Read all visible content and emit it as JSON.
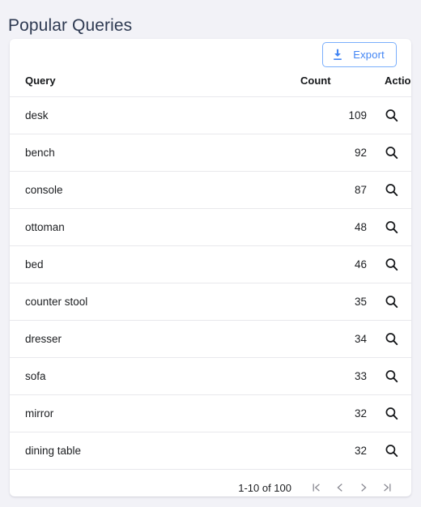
{
  "page": {
    "title": "Popular Queries",
    "background_color": "#f2f2f7",
    "title_color": "#2e3a52"
  },
  "toolbar": {
    "export_label": "Export",
    "export_icon": "download-icon",
    "accent_color": "#4285f4"
  },
  "table": {
    "columns": [
      {
        "key": "query",
        "label": "Query"
      },
      {
        "key": "count",
        "label": "Count"
      },
      {
        "key": "actions",
        "label": "Actions"
      }
    ],
    "row_action_icon": "search-icon",
    "rows": [
      {
        "query": "desk",
        "count": "109"
      },
      {
        "query": "bench",
        "count": "92"
      },
      {
        "query": "console",
        "count": "87"
      },
      {
        "query": "ottoman",
        "count": "48"
      },
      {
        "query": "bed",
        "count": "46"
      },
      {
        "query": "counter stool",
        "count": "35"
      },
      {
        "query": "dresser",
        "count": "34"
      },
      {
        "query": "sofa",
        "count": "33"
      },
      {
        "query": "mirror",
        "count": "32"
      },
      {
        "query": "dining table",
        "count": "32"
      }
    ]
  },
  "pagination": {
    "range_label": "1-10 of 100",
    "buttons": [
      {
        "name": "first-page-button",
        "icon": "first-page-icon"
      },
      {
        "name": "previous-page-button",
        "icon": "chevron-left-icon"
      },
      {
        "name": "next-page-button",
        "icon": "chevron-right-icon"
      },
      {
        "name": "last-page-button",
        "icon": "last-page-icon"
      }
    ]
  }
}
